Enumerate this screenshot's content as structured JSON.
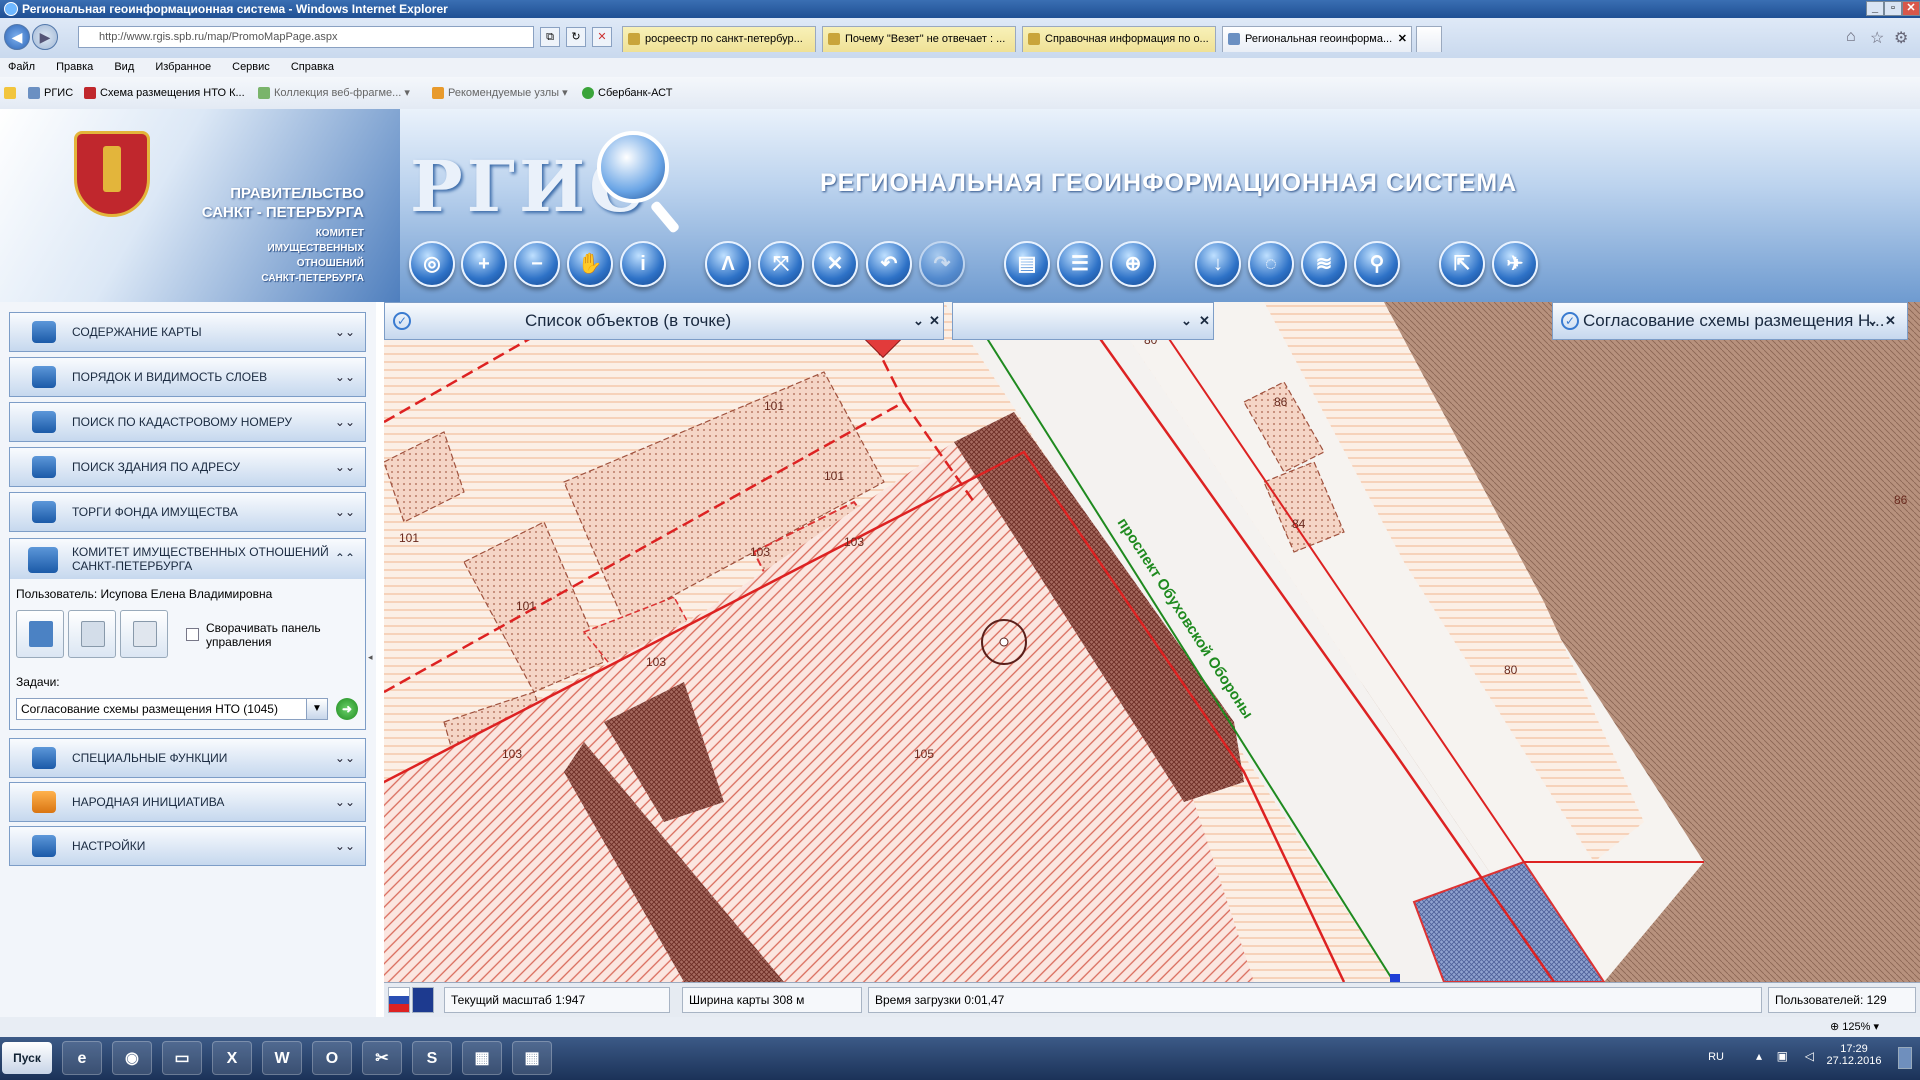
{
  "window": {
    "title": "Региональная геоинформационная система - Windows Internet Explorer"
  },
  "browser": {
    "address": "http://www.rgis.spb.ru/map/PromoMapPage.aspx",
    "tabs": [
      {
        "label": "росреестр по санкт-петербур..."
      },
      {
        "label": "Почему \"Везет\" не отвечает : ..."
      },
      {
        "label": "Справочная информация по о..."
      },
      {
        "label": "Региональная геоинформа..."
      }
    ],
    "menu": [
      "Файл",
      "Правка",
      "Вид",
      "Избранное",
      "Сервис",
      "Справка"
    ],
    "favorites": [
      "РГИС",
      "Схема размещения НТО К...",
      "Коллекция веб-фрагме...",
      "Рекомендуемые узлы",
      "Сбербанк-АСТ"
    ]
  },
  "header": {
    "gov_line1": "ПРАВИТЕЛЬСТВО",
    "gov_line2": "САНКТ - ПЕТЕРБУРГА",
    "committee": [
      "КОМИТЕТ",
      "ИМУЩЕСТВЕННЫХ",
      "ОТНОШЕНИЙ",
      "САНКТ-ПЕТЕРБУРГА"
    ],
    "logo": "РГИС",
    "system_title": "РЕГИОНАЛЬНАЯ  ГЕОИНФОРМАЦИОННАЯ СИСТЕМА"
  },
  "toolbar_icons": [
    "globe-icon",
    "zoom-in-icon",
    "zoom-out-icon",
    "pan-hand-icon",
    "info-icon",
    "measure-icon",
    "select-icon",
    "clear-icon",
    "back-icon",
    "forward-icon",
    "print-icon",
    "list-icon",
    "locate-icon",
    "download-icon",
    "comment-icon",
    "rss-icon",
    "pin-icon",
    "export-icon",
    "plane-icon"
  ],
  "left_panel": {
    "items": [
      {
        "label": "СОДЕРЖАНИЕ КАРТЫ"
      },
      {
        "label": "ПОРЯДОК И ВИДИМОСТЬ СЛОЕВ"
      },
      {
        "label": "ПОИСК ПО КАДАСТРОВОМУ НОМЕРУ"
      },
      {
        "label": "ПОИСК ЗДАНИЯ ПО АДРЕСУ"
      },
      {
        "label": "ТОРГИ ФОНДА ИМУЩЕСТВА"
      }
    ],
    "committee_panel": {
      "title_line1": "КОМИТЕТ ИМУЩЕСТВЕННЫХ ОТНОШЕНИЙ",
      "title_line2": "САНКТ-ПЕТЕРБУРГА",
      "user": "Пользователь: Исупова Елена Владимировна",
      "collapse_label_1": "Сворачивать панель",
      "collapse_label_2": "управления",
      "tasks_label": "Задачи:",
      "task_value": "Согласование схемы размещения НТО (1045)"
    },
    "items_bottom": [
      {
        "label": "СПЕЦИАЛЬНЫЕ ФУНКЦИИ"
      },
      {
        "label": "НАРОДНАЯ ИНИЦИАТИВА"
      },
      {
        "label": "НАСТРОЙКИ"
      }
    ]
  },
  "map": {
    "panel_objects_title": "Список объектов (в точке)",
    "panel_approval_title": "Согласование схемы размещения Н...",
    "street_label": "проспект Обуховской Обороны",
    "parcels": [
      "101",
      "101",
      "101",
      "101",
      "103",
      "103",
      "103",
      "103",
      "105",
      "86",
      "84",
      "80",
      "80",
      "86"
    ]
  },
  "status": {
    "scale": "Текущий масштаб 1:947",
    "width": "Ширина карты 308 м",
    "load": "Время загрузки 0:01,47",
    "users": "Пользователей: 129"
  },
  "zoom": "125%",
  "taskbar": {
    "start": "Пуск",
    "lang": "RU",
    "time": "17:29",
    "date": "27.12.2016"
  }
}
